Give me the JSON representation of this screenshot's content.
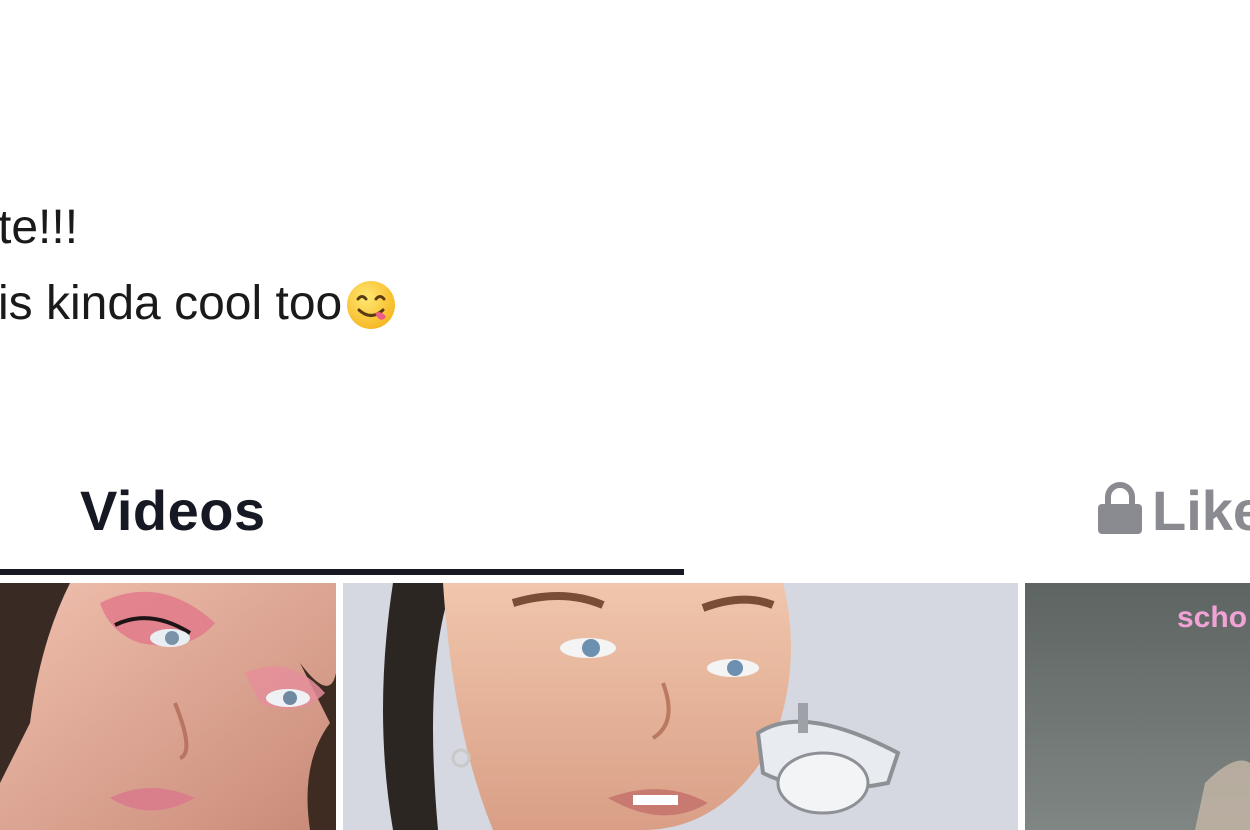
{
  "profile": {
    "bio_lines": [
      "te!!!",
      "is kinda cool too"
    ],
    "bio_emoji": "face-savoring-food-icon"
  },
  "tabs": [
    {
      "label": "Videos",
      "active": true
    },
    {
      "label": "Like",
      "active": false,
      "icon": "lock-icon"
    }
  ],
  "videos": [
    {
      "thumbnail": "portrait-pink-eyeshadow"
    },
    {
      "thumbnail": "portrait-ceiling-light"
    },
    {
      "thumbnail": "gray-wall-text",
      "overlay_text": "scho"
    }
  ],
  "colors": {
    "text_primary": "#161823",
    "text_inactive": "#8a8b91",
    "overlay_text": "#f2a3d6"
  }
}
